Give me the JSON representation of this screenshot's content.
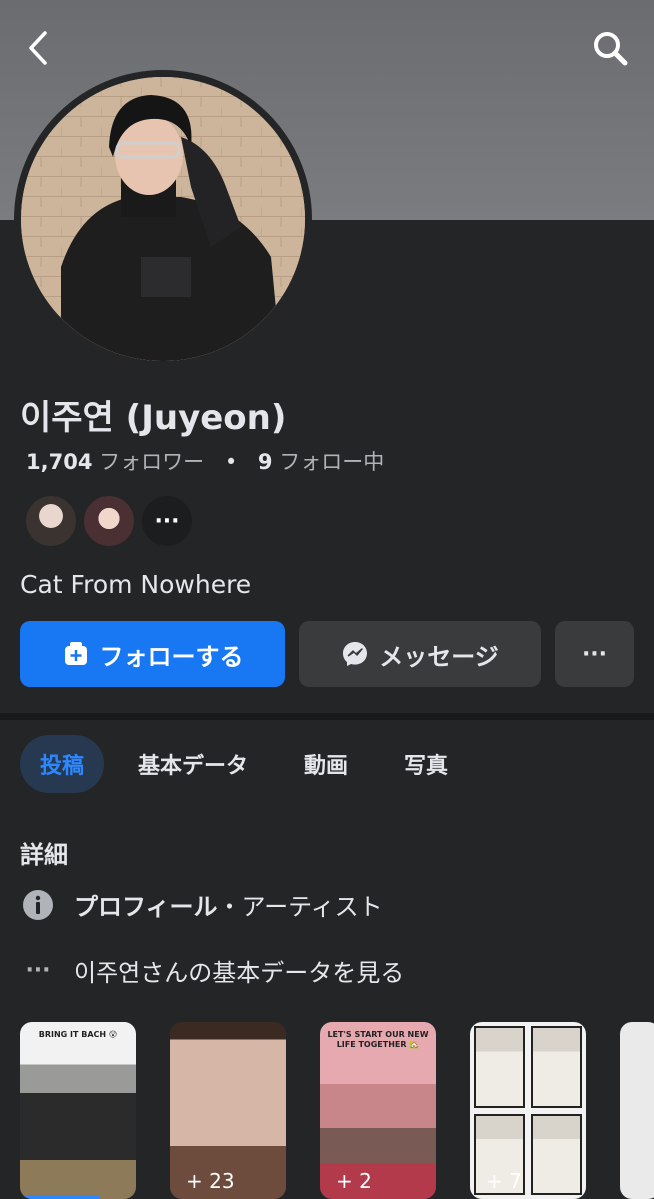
{
  "profile": {
    "name": "이주연 (Juyeon)",
    "followers_count": "1,704",
    "followers_label": "フォロワー",
    "following_count": "9",
    "following_label": "フォロー中",
    "bio": "Cat From Nowhere"
  },
  "actions": {
    "follow_label": "フォローする",
    "message_label": "メッセージ",
    "more_label": "···"
  },
  "tabs": [
    {
      "label": "投稿",
      "active": true
    },
    {
      "label": "基本データ",
      "active": false
    },
    {
      "label": "動画",
      "active": false
    },
    {
      "label": "写真",
      "active": false
    }
  ],
  "details": {
    "title": "詳細",
    "profile_type_bold": "プロフィール",
    "profile_type_rest": "・アーティスト",
    "see_about": "이주연さんの基本データを見る"
  },
  "photos": [
    {
      "caption": "BRING IT BACH 😮",
      "count": ""
    },
    {
      "caption": "",
      "count": "+ 23"
    },
    {
      "caption": "LET'S START OUR NEW LIFE TOGETHER 🏡",
      "count": "+ 2"
    },
    {
      "caption": "",
      "count": "+ 7"
    }
  ],
  "icons": {
    "back": "chevron-left-icon",
    "search": "search-icon",
    "follow": "add-friend-icon",
    "message": "messenger-icon",
    "info": "info-icon",
    "more": "more-dots-icon"
  },
  "colors": {
    "accent": "#1877f2",
    "background": "#242526",
    "button_secondary": "#3a3b3c",
    "active_tab_bg": "#263951"
  }
}
